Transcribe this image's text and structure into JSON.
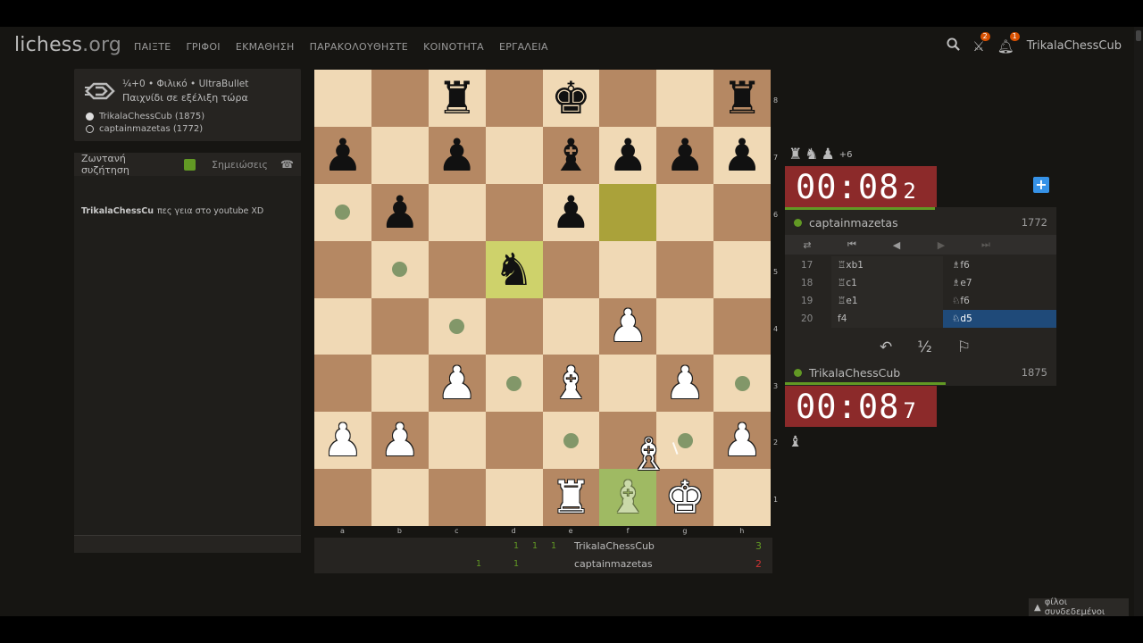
{
  "topbar": {
    "logo_main": "lichess",
    "logo_suffix": ".org",
    "nav": [
      "ΠΑΙΞΤΕ",
      "ΓΡΙΦΟΙ",
      "ΕΚΜΑΘΗΣΗ",
      "ΠΑΡΑΚΟΛΟΥΘΗΣΤΕ",
      "ΚΟΙΝΟΤΗΤΑ",
      "ΕΡΓΑΛΕΙΑ"
    ],
    "challenges_count": "2",
    "notifications_count": "1",
    "username": "TrikalaChessCub"
  },
  "game_info": {
    "line1": "¼+0 • Φιλικό • UltraBullet",
    "line2": "Παιχνίδι σε εξέλιξη τώρα",
    "white": "TrikalaChessCub (1875)",
    "black": "captainmazetas (1772)"
  },
  "chat": {
    "tab_live": "Ζωντανή συζήτηση",
    "tab_notes": "Σημειώσεις",
    "message_user": "TrikalaChessCu",
    "message_text": "πες γεια στο youtube XD"
  },
  "board": {
    "ranks": [
      "8",
      "7",
      "6",
      "5",
      "4",
      "3",
      "2",
      "1"
    ],
    "files": [
      "a",
      "b",
      "c",
      "d",
      "e",
      "f",
      "g",
      "h"
    ],
    "squares": [
      [
        "",
        "",
        "bR",
        "",
        "bK",
        "",
        "",
        "bR"
      ],
      [
        "bP",
        "",
        "bP",
        "",
        "bB",
        "bP",
        "bP",
        "bP"
      ],
      [
        ".",
        "bP",
        "",
        "",
        "bP",
        "",
        "",
        ""
      ],
      [
        "",
        ".",
        "",
        "bN",
        "",
        "",
        "",
        ""
      ],
      [
        "",
        "",
        ".",
        "",
        "",
        "wP",
        "",
        ""
      ],
      [
        "",
        "",
        "wP",
        ".",
        "wB",
        "",
        "wP",
        "."
      ],
      [
        "wP",
        "wP",
        "",
        "",
        ".",
        "",
        ".",
        "wP"
      ],
      [
        "",
        "",
        "",
        "",
        "wR",
        "gB",
        "wK",
        ""
      ]
    ],
    "last_move": [
      "d5",
      "f6"
    ],
    "selected": "f1",
    "dragging_piece": "white-bishop"
  },
  "crosstable": {
    "rows": [
      {
        "name": "TrikalaChessCub",
        "total": "3",
        "total_color": "#629924",
        "cells": [
          {
            "pos": 3,
            "v": "1"
          },
          {
            "pos": 4,
            "v": "1"
          },
          {
            "pos": 5,
            "v": "1"
          }
        ]
      },
      {
        "name": "captainmazetas",
        "total": "2",
        "total_color": "#cc3333",
        "cells": [
          {
            "pos": 1,
            "v": "1"
          },
          {
            "pos": 3,
            "v": "1"
          }
        ]
      }
    ]
  },
  "material": {
    "top_plus": "+6"
  },
  "clocks": {
    "top_main": "00:08",
    "top_frac": "2",
    "bottom_main": "00:08",
    "bottom_frac": "7"
  },
  "players": {
    "top_name": "captainmazetas",
    "top_rating": "1772",
    "bottom_name": "TrikalaChessCub",
    "bottom_rating": "1875"
  },
  "moves": [
    {
      "num": "17",
      "white": "♖xb1",
      "black": "♗f6"
    },
    {
      "num": "18",
      "white": "♖c1",
      "black": "♗e7"
    },
    {
      "num": "19",
      "white": "♖e1",
      "black": "♘f6"
    },
    {
      "num": "20",
      "white": "f4",
      "black": "♘d5"
    }
  ],
  "actions": {
    "draw": "½"
  },
  "friends": {
    "label": "φίλοι συνδεδεμένοι"
  }
}
